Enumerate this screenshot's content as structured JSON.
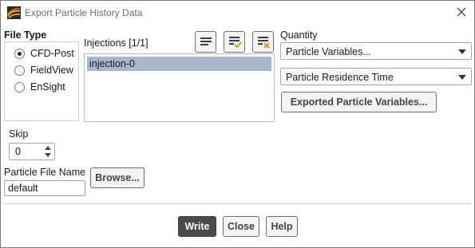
{
  "window": {
    "title": "Export Particle History Data"
  },
  "file_type": {
    "label": "File Type",
    "options": [
      {
        "label": "CFD-Post",
        "selected": true
      },
      {
        "label": "FieldView",
        "selected": false
      },
      {
        "label": "EnSight",
        "selected": false
      }
    ]
  },
  "injections": {
    "label": "Injections [1/1]",
    "items": [
      {
        "label": "injection-0",
        "selected": true
      }
    ],
    "toolbar_icons": [
      "select-none-icon",
      "select-all-icon",
      "deselect-all-icon"
    ]
  },
  "quantity": {
    "label": "Quantity",
    "category_value": "Particle Variables...",
    "variable_value": "Particle Residence Time",
    "exported_button": "Exported Particle Variables..."
  },
  "skip": {
    "label": "Skip",
    "value": "0"
  },
  "particle_file": {
    "label": "Particle File Name",
    "value": "default",
    "browse_label": "Browse..."
  },
  "actions": {
    "write": "Write",
    "close": "Close",
    "help": "Help"
  },
  "colors": {
    "selection": "#a7b7cc",
    "primary_button": "#4a4a4a"
  }
}
